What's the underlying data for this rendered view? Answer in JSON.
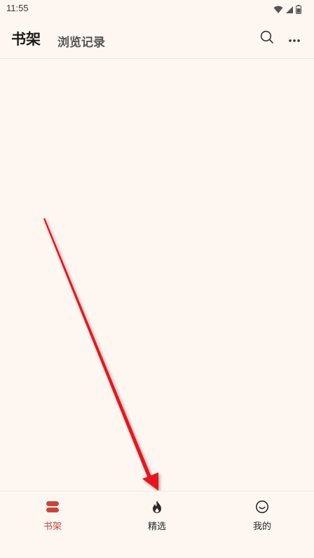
{
  "status_bar": {
    "time": "11:55"
  },
  "header": {
    "title": "书架",
    "history_tab": "浏览记录",
    "search_icon": "search-icon",
    "more_icon": "more-icon"
  },
  "bottom_nav": {
    "items": [
      {
        "label": "书架",
        "icon": "bookshelf-icon",
        "active": true
      },
      {
        "label": "精选",
        "icon": "flame-icon",
        "active": false
      },
      {
        "label": "我的",
        "icon": "smiley-icon",
        "active": false
      }
    ]
  },
  "colors": {
    "background": "#fdf6f1",
    "accent": "#c9453c",
    "annotation_arrow": "#e8181a"
  }
}
